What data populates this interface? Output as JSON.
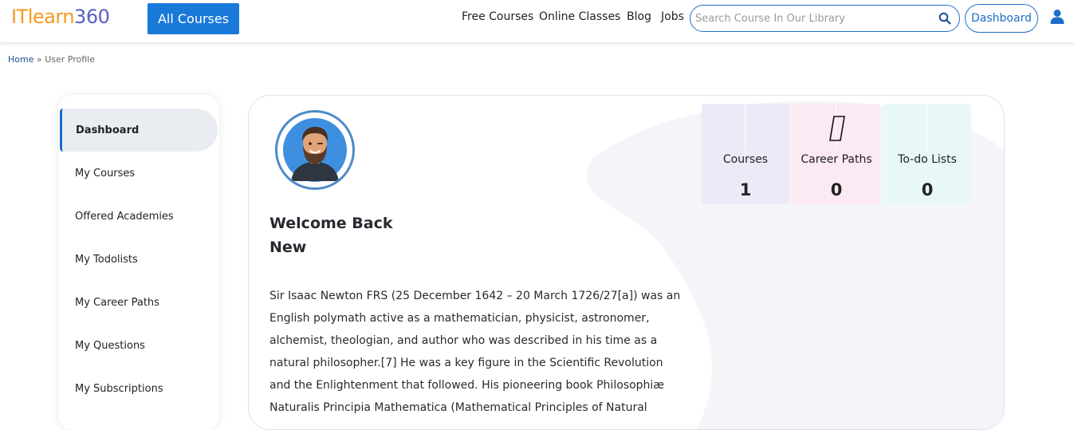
{
  "header": {
    "logo_part1": "ITlearn",
    "logo_part2": "360",
    "all_courses_label": "All Courses",
    "nav": [
      "Free Courses",
      "Online Classes",
      "Blog",
      "Jobs"
    ],
    "search_placeholder": "Search Course In Our Library",
    "dashboard_label": "Dashboard"
  },
  "breadcrumb": {
    "home": "Home",
    "separator": " » ",
    "current": "User Profile"
  },
  "sidebar": {
    "items": [
      {
        "label": "Dashboard",
        "active": true
      },
      {
        "label": "My Courses"
      },
      {
        "label": "Offered Academies"
      },
      {
        "label": "My Todolists"
      },
      {
        "label": "My Career Paths"
      },
      {
        "label": "My Questions"
      },
      {
        "label": "My Subscriptions"
      }
    ]
  },
  "profile": {
    "welcome_line1": "Welcome Back",
    "welcome_line2": "New",
    "bio": "Sir Isaac Newton FRS (25 December 1642 – 20 March 1726/27[a]) was an English polymath active as a mathematician, physicist, astronomer, alchemist, theologian, and author who was described in his time as a natural philosopher.[7] He was a key figure in the Scientific Revolution and the Enlightenment that followed. His pioneering book Philosophiæ Naturalis Principia Mathematica (Mathematical Principles of Natural"
  },
  "stats": {
    "courses": {
      "label": "Courses",
      "value": "1"
    },
    "career_paths": {
      "label": "Career Paths",
      "value": "0"
    },
    "todo_lists": {
      "label": "To-do Lists",
      "value": "0"
    }
  },
  "colors": {
    "primary": "#1979d9",
    "logo_orange": "#f59a1f",
    "logo_purple": "#5a5fc6",
    "courses_bg": "#ede9f7",
    "career_bg": "#fbe9f3",
    "todo_bg": "#e8f8f7"
  }
}
